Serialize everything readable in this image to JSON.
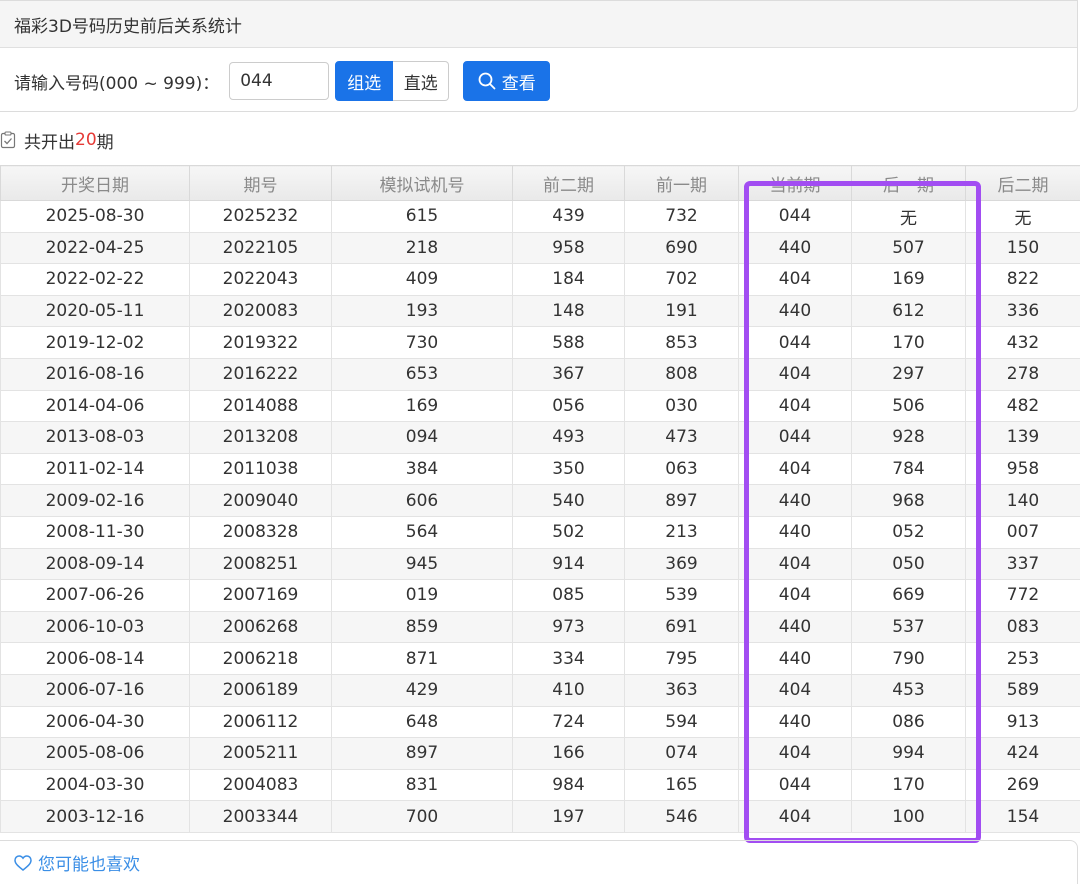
{
  "header": {
    "title": "福彩3D号码历史前后关系统计"
  },
  "query": {
    "label": "请输入号码(000 ~ 999)：",
    "value": "044",
    "btn_group": "组选",
    "btn_direct": "直选",
    "btn_view": "查看"
  },
  "summary": {
    "prefix": "共开出",
    "count": "20",
    "suffix": "期"
  },
  "table": {
    "headers": [
      "开奖日期",
      "期号",
      "模拟试机号",
      "前二期",
      "前一期",
      "当前期",
      "后一期",
      "后二期"
    ],
    "rows": [
      [
        "2025-08-30",
        "2025232",
        "615",
        "439",
        "732",
        "044",
        "无",
        "无"
      ],
      [
        "2022-04-25",
        "2022105",
        "218",
        "958",
        "690",
        "440",
        "507",
        "150"
      ],
      [
        "2022-02-22",
        "2022043",
        "409",
        "184",
        "702",
        "404",
        "169",
        "822"
      ],
      [
        "2020-05-11",
        "2020083",
        "193",
        "148",
        "191",
        "440",
        "612",
        "336"
      ],
      [
        "2019-12-02",
        "2019322",
        "730",
        "588",
        "853",
        "044",
        "170",
        "432"
      ],
      [
        "2016-08-16",
        "2016222",
        "653",
        "367",
        "808",
        "404",
        "297",
        "278"
      ],
      [
        "2014-04-06",
        "2014088",
        "169",
        "056",
        "030",
        "404",
        "506",
        "482"
      ],
      [
        "2013-08-03",
        "2013208",
        "094",
        "493",
        "473",
        "044",
        "928",
        "139"
      ],
      [
        "2011-02-14",
        "2011038",
        "384",
        "350",
        "063",
        "404",
        "784",
        "958"
      ],
      [
        "2009-02-16",
        "2009040",
        "606",
        "540",
        "897",
        "440",
        "968",
        "140"
      ],
      [
        "2008-11-30",
        "2008328",
        "564",
        "502",
        "213",
        "440",
        "052",
        "007"
      ],
      [
        "2008-09-14",
        "2008251",
        "945",
        "914",
        "369",
        "404",
        "050",
        "337"
      ],
      [
        "2007-06-26",
        "2007169",
        "019",
        "085",
        "539",
        "404",
        "669",
        "772"
      ],
      [
        "2006-10-03",
        "2006268",
        "859",
        "973",
        "691",
        "440",
        "537",
        "083"
      ],
      [
        "2006-08-14",
        "2006218",
        "871",
        "334",
        "795",
        "440",
        "790",
        "253"
      ],
      [
        "2006-07-16",
        "2006189",
        "429",
        "410",
        "363",
        "404",
        "453",
        "589"
      ],
      [
        "2006-04-30",
        "2006112",
        "648",
        "724",
        "594",
        "440",
        "086",
        "913"
      ],
      [
        "2005-08-06",
        "2005211",
        "897",
        "166",
        "074",
        "404",
        "994",
        "424"
      ],
      [
        "2004-03-30",
        "2004083",
        "831",
        "984",
        "165",
        "044",
        "170",
        "269"
      ],
      [
        "2003-12-16",
        "2003344",
        "700",
        "197",
        "546",
        "404",
        "100",
        "154"
      ]
    ]
  },
  "recommend": {
    "label": "您可能也喜欢"
  },
  "colors": {
    "accent": "#1a73e8",
    "count": "#e53935",
    "highlight": "#a24df2",
    "link": "#3a8ee6"
  }
}
